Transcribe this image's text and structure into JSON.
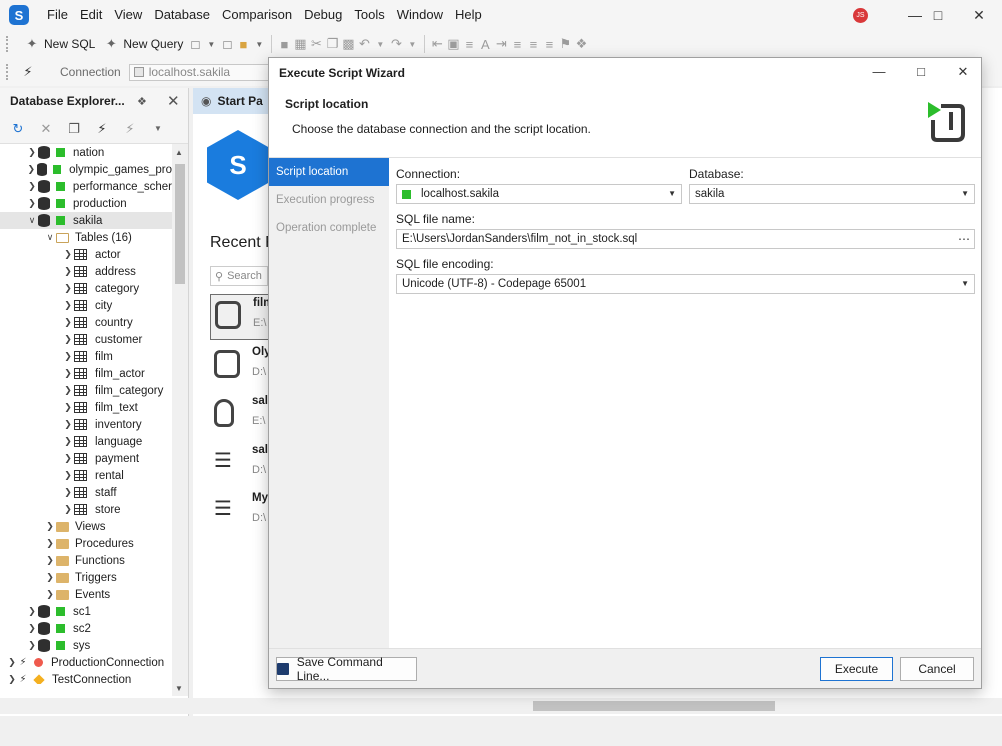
{
  "menu": [
    "File",
    "Edit",
    "View",
    "Database",
    "Comparison",
    "Debug",
    "Tools",
    "Window",
    "Help"
  ],
  "user_initials": "JS",
  "toolbar": {
    "new_sql": "New SQL",
    "new_query": "New Query"
  },
  "connection_bar": {
    "label": "Connection",
    "value": "localhost.sakila"
  },
  "explorer": {
    "title": "Database Explorer...",
    "tree": {
      "databases_top": [
        "nation",
        "olympic_games_pro",
        "performance_scher",
        "production"
      ],
      "sakila": "sakila",
      "tables_folder": "Tables (16)",
      "tables": [
        "actor",
        "address",
        "category",
        "city",
        "country",
        "customer",
        "film",
        "film_actor",
        "film_category",
        "film_text",
        "inventory",
        "language",
        "payment",
        "rental",
        "staff",
        "store"
      ],
      "folders": [
        "Views",
        "Procedures",
        "Functions",
        "Triggers",
        "Events"
      ],
      "databases_bottom": [
        "sc1",
        "sc2",
        "sys"
      ],
      "connections": [
        "ProductionConnection",
        "TestConnection"
      ]
    }
  },
  "start_page": {
    "tab": "Start Pa",
    "recent_title": "Recent F",
    "search_placeholder": "Search",
    "recent": [
      {
        "title": "film",
        "path": "E:\\"
      },
      {
        "title": "Oly",
        "path": "D:\\"
      },
      {
        "title": "sal",
        "path": "E:\\"
      },
      {
        "title": "sal",
        "path": "D:\\"
      },
      {
        "title": "My",
        "path": "D:\\"
      }
    ]
  },
  "wizard": {
    "title": "Execute Script Wizard",
    "header_title": "Script location",
    "header_desc": "Choose the database connection and the script location.",
    "nav": [
      "Script location",
      "Execution progress",
      "Operation complete"
    ],
    "connection_label": "Connection:",
    "connection_value": "localhost.sakila",
    "database_label": "Database:",
    "database_value": "sakila",
    "sql_file_label": "SQL file name:",
    "sql_file_value": "E:\\Users\\JordanSanders\\film_not_in_stock.sql",
    "encoding_label": "SQL file encoding:",
    "encoding_value": "Unicode (UTF-8) - Codepage 65001",
    "save_cmd": "Save Command Line...",
    "execute": "Execute",
    "cancel": "Cancel"
  },
  "colors": {
    "accent": "#1e73d2",
    "green": "#2cbd2c",
    "red": "#ef5a4d"
  }
}
